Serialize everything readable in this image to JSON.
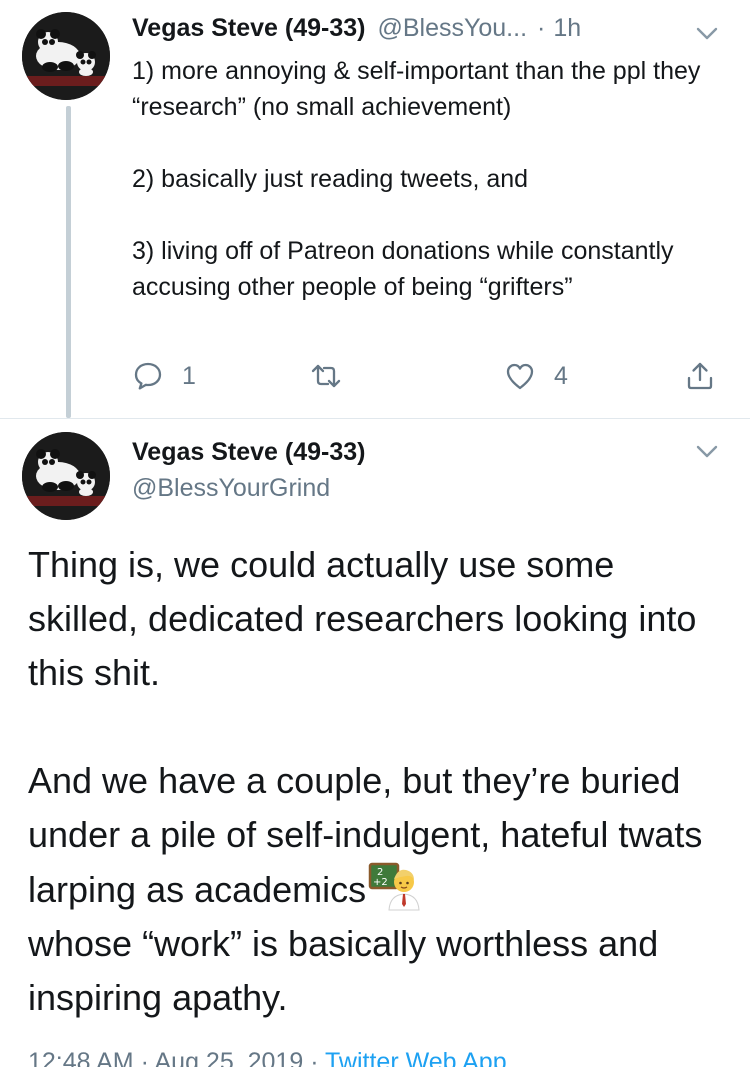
{
  "reply": {
    "name": "Vegas Steve (49-33)",
    "handle": "@BlessYou...",
    "separator": "·",
    "time": "1h",
    "paragraphs": [
      "1) more annoying & self-important than the ppl they “research” (no small achievement)",
      "2) basically just reading tweets, and",
      "3) living off of Patreon donations while constantly accusing other people of being “grifters”"
    ],
    "actions": {
      "reply_icon": "reply-icon",
      "reply_count": "1",
      "retweet_icon": "retweet-icon",
      "like_icon": "heart-icon",
      "like_count": "4",
      "share_icon": "share-icon"
    }
  },
  "main": {
    "name": "Vegas Steve (49-33)",
    "handle": "@BlessYourGrind",
    "paragraphs": [
      "Thing is, we could actually use some skilled, dedicated researchers looking into this shit.",
      "And we have a couple, but they’re buried under a pile of self-indulgent, hateful twats larping as academics"
    ],
    "paragraph_tail": "whose “work” is basically worthless and inspiring apathy.",
    "emoji": "teacher-emoji",
    "meta": {
      "time": "12:48 AM",
      "separator": "·",
      "date": "Aug 25, 2019",
      "source": "Twitter Web App"
    }
  },
  "colors": {
    "text": "#14171a",
    "secondary": "#657786",
    "link": "#1da1f2",
    "thread_line": "#c4cfd6",
    "divider": "#e1e8ed"
  }
}
